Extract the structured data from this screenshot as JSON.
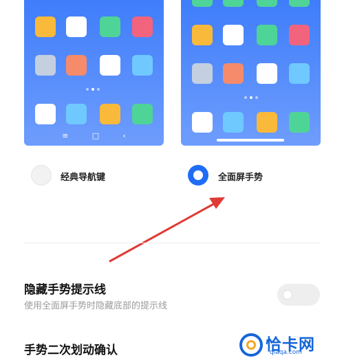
{
  "options": {
    "classic": {
      "label": "经典导航键",
      "selected": false
    },
    "gesture": {
      "label": "全面屏手势",
      "selected": true
    }
  },
  "phones": {
    "classic": {
      "nav_icons": [
        "≡",
        "□",
        "‹"
      ],
      "app_colors": [
        "#f9b93b",
        "#ffffff",
        "#4fd497",
        "#f2647d",
        "#c4d0e0",
        "#f58b6a",
        "#ffffff",
        "#6fc9ff",
        "#ffffff",
        "#6fc9ff",
        "#f9b93b",
        "#4fd497"
      ]
    },
    "gesture": {
      "app_colors": [
        "#4fd497",
        "#4fd497",
        "#4fd497",
        "#4fd497",
        "#f9b93b",
        "#ffffff",
        "#4fd497",
        "#f2647d",
        "#c4d0e0",
        "#f58b6a",
        "#ffffff",
        "#6fc9ff",
        "#ffffff",
        "#6fc9ff",
        "#f9b93b",
        "#4fd497"
      ]
    }
  },
  "settings": {
    "hide_hint_line": {
      "title": "隐藏手势提示线",
      "subtitle": "使用全面屏手势时隐藏底部的提示线",
      "enabled": false
    },
    "second_swipe_confirm": {
      "title": "手势二次划动确认"
    }
  },
  "colors": {
    "accent": "#1f6df5",
    "wallpaper_top": "#3f7dfb",
    "annotation_arrow": "#e03a34"
  },
  "watermark": {
    "title": "恰卡网",
    "url": "qiaqa.com"
  }
}
